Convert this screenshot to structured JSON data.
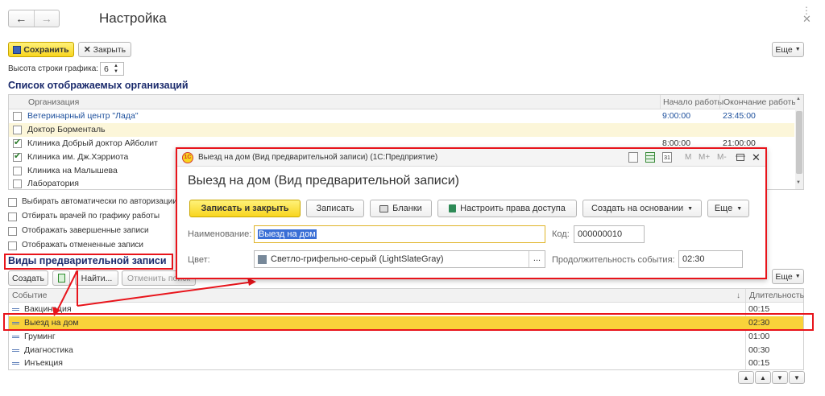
{
  "main": {
    "title": "Настройка",
    "toolbar": {
      "save": "Сохранить",
      "close": "Закрыть",
      "more": "Еще"
    },
    "row_height_label": "Высота строки графика:",
    "row_height_value": "6",
    "orgs_title": "Список отображаемых организаций",
    "org_columns": {
      "org": "Организация",
      "start": "Начало работы",
      "end": "Окончание работы"
    },
    "org_rows": [
      {
        "name": "Ветеринарный центр \"Лада\"",
        "start": "9:00:00",
        "end": "23:45:00",
        "checked": false
      },
      {
        "name": "Доктор Борменталь",
        "start": "",
        "end": "",
        "checked": false
      },
      {
        "name": "Клиника Добрый доктор Айболит",
        "start": "8:00:00",
        "end": "21:00:00",
        "checked": true
      },
      {
        "name": "Клиника им. Дж.Хэрриота",
        "start": "",
        "end": "",
        "checked": true
      },
      {
        "name": "Клиника на Малышева",
        "start": "",
        "end": "",
        "checked": false
      },
      {
        "name": "Лаборатория",
        "start": "",
        "end": "",
        "checked": false
      }
    ],
    "options": [
      "Выбирать автоматически по авторизации",
      "Отбирать врачей по графику работы",
      "Отображать завершенные записи",
      "Отображать отмененные записи"
    ],
    "types_title": "Виды предварительной записи",
    "types_toolbar": {
      "create": "Создать",
      "find": "Найти...",
      "cancel_search": "Отменить поиск",
      "more": "Еще"
    },
    "types_columns": {
      "event": "Событие",
      "duration": "Длительность"
    },
    "types_rows": [
      {
        "name": "Вакцинация",
        "duration": "00:15"
      },
      {
        "name": "Выезд на дом",
        "duration": "02:30"
      },
      {
        "name": "Груминг",
        "duration": "01:00"
      },
      {
        "name": "Диагностика",
        "duration": "00:30"
      },
      {
        "name": "Инъекция",
        "duration": "00:15"
      }
    ]
  },
  "dialog": {
    "window_title": "Выезд на дом (Вид предварительной записи)  (1С:Предприятие)",
    "header": "Выезд на дом (Вид предварительной записи)",
    "buttons": {
      "save_close": "Записать и закрыть",
      "save": "Записать",
      "forms": "Бланки",
      "rights": "Настроить права доступа",
      "create_basis": "Создать на основании",
      "more": "Еще"
    },
    "name_label": "Наименование:",
    "name_value": "Выезд на дом",
    "code_label": "Код:",
    "code_value": "000000010",
    "color_label": "Цвет:",
    "color_value": "Светло-грифельно-серый (LightSlateGray)",
    "color_swatch": "#778899",
    "duration_label": "Продолжительность события:",
    "duration_value": "02:30",
    "title_icons": [
      "M",
      "M+",
      "M-"
    ]
  },
  "colors": {
    "highlight": "#e8141b",
    "selected_row": "#f9d23a",
    "hover_row": "#fcf6d9"
  }
}
